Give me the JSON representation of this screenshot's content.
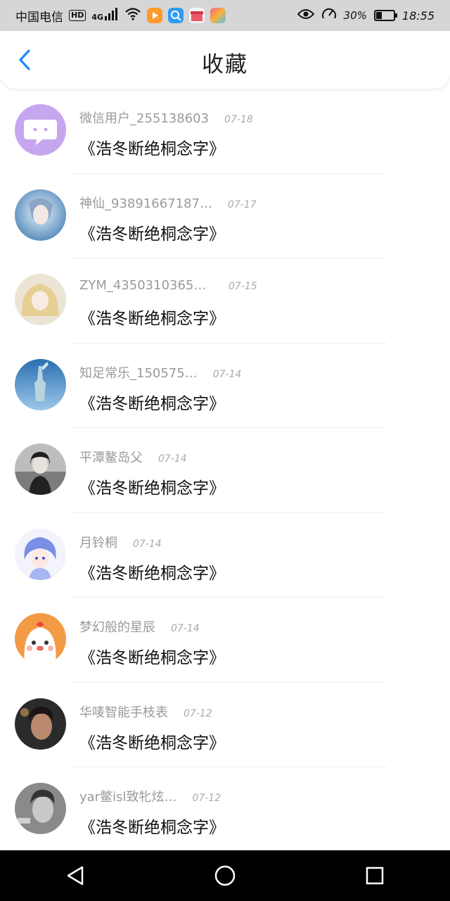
{
  "status_bar": {
    "carrier": "中国电信",
    "hd": "HD",
    "network": "4G",
    "battery_percent": "30%",
    "time": "18:55"
  },
  "header": {
    "title": "收藏",
    "back_icon": "chevron-left-icon"
  },
  "colors": {
    "accent": "#1a8cff",
    "meta_text": "#9a9a9a",
    "nav_bg": "#000000"
  },
  "favorites": [
    {
      "user": "微信用户_255138603",
      "date": "07-18",
      "title": "《浩冬断绝桐念字》"
    },
    {
      "user": "神仙_93891667187…",
      "date": "07-17",
      "title": "《浩冬断绝桐念字》"
    },
    {
      "user": "ZYM_435031036586…",
      "date": "07-15",
      "title": "《浩冬断绝桐念字》"
    },
    {
      "user": "知足常乐_150575…",
      "date": "07-14",
      "title": "《浩冬断绝桐念字》"
    },
    {
      "user": "平潭鳌岛父",
      "date": "07-14",
      "title": "《浩冬断绝桐念字》"
    },
    {
      "user": "月铃桐",
      "date": "07-14",
      "title": "《浩冬断绝桐念字》"
    },
    {
      "user": "梦幻般的星辰",
      "date": "07-14",
      "title": "《浩冬断绝桐念字》"
    },
    {
      "user": "华唛智能手枝表",
      "date": "07-12",
      "title": "《浩冬断绝桐念字》"
    },
    {
      "user": "yar鳖isl致牝炫…",
      "date": "07-12",
      "title": "《浩冬断绝桐念字》"
    }
  ],
  "nav": [
    "back-triangle-icon",
    "home-circle-icon",
    "recents-square-icon"
  ]
}
